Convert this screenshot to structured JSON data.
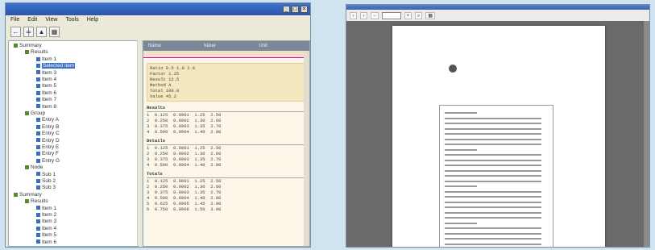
{
  "left_window": {
    "menu": [
      "File",
      "Edit",
      "View",
      "Tools",
      "Help"
    ],
    "toolbar_icons": [
      "back-icon",
      "tree-icon",
      "chart-icon",
      "print-icon"
    ],
    "tree": [
      {
        "label": "Summary",
        "level": 0
      },
      {
        "label": "Results",
        "level": 1
      },
      {
        "label": "Item 1",
        "level": 2
      },
      {
        "label": "Selected item",
        "level": 2,
        "selected": true
      },
      {
        "label": "Item 3",
        "level": 2
      },
      {
        "label": "Item 4",
        "level": 2
      },
      {
        "label": "Item 5",
        "level": 2
      },
      {
        "label": "Item 6",
        "level": 2
      },
      {
        "label": "Item 7",
        "level": 2
      },
      {
        "label": "Item 8",
        "level": 2
      },
      {
        "label": "Group",
        "level": 1
      },
      {
        "label": "Entry A",
        "level": 2
      },
      {
        "label": "Entry B",
        "level": 2
      },
      {
        "label": "Entry C",
        "level": 2
      },
      {
        "label": "Entry D",
        "level": 2
      },
      {
        "label": "Entry E",
        "level": 2
      },
      {
        "label": "Entry F",
        "level": 2
      },
      {
        "label": "Entry G",
        "level": 2
      },
      {
        "label": "Node",
        "level": 1
      },
      {
        "label": "Sub 1",
        "level": 2
      },
      {
        "label": "Sub 2",
        "level": 2
      },
      {
        "label": "Sub 3",
        "level": 2
      },
      {
        "label": "Summary",
        "level": 0
      },
      {
        "label": "Results",
        "level": 1
      },
      {
        "label": "Item 1",
        "level": 2
      },
      {
        "label": "Item 2",
        "level": 2
      },
      {
        "label": "Item 3",
        "level": 2
      },
      {
        "label": "Item 4",
        "level": 2
      },
      {
        "label": "Item 5",
        "level": 2
      },
      {
        "label": "Item 6",
        "level": 2
      }
    ],
    "report": {
      "header": [
        "Name",
        "Value",
        "Unit"
      ],
      "summary_lines": [
        "Ratio 0.5 1.0 2.0",
        "Factor 1.25",
        "Result 12.5",
        "Method A",
        "Total 100.0",
        "Value 45.2"
      ],
      "sections": [
        {
          "title": "Results",
          "rows": [
            "1  0.125  0.0001  1.25  2.50",
            "2  0.250  0.0002  1.30  2.60",
            "3  0.375  0.0003  1.35  2.70",
            "4  0.500  0.0004  1.40  2.80"
          ]
        },
        {
          "title": "Details",
          "rows": [
            "1  0.125  0.0001  1.25  2.50",
            "2  0.250  0.0002  1.30  2.60",
            "3  0.375  0.0003  1.35  2.70",
            "4  0.500  0.0004  1.40  2.80"
          ]
        },
        {
          "title": "Totals",
          "rows": [
            "1  0.125  0.0001  1.25  2.50",
            "2  0.250  0.0002  1.30  2.60",
            "3  0.375  0.0003  1.35  2.70",
            "4  0.500  0.0004  1.40  2.80",
            "5  0.625  0.0005  1.45  2.90",
            "6  0.750  0.0006  1.50  3.00"
          ]
        }
      ]
    }
  },
  "right_window": {
    "toolbar_icons": [
      "prev-page-icon",
      "next-page-icon",
      "zoom-out-icon",
      "zoom-in-icon",
      "find-icon",
      "print-icon"
    ],
    "page_lines": 26
  },
  "colors": {
    "tree_selected": "#3a6fc4",
    "report_bg": "#fcf6e8",
    "summary_bg": "#f5e8bf",
    "titlebar": "#2a56b0",
    "accent": "#c45a1a"
  }
}
